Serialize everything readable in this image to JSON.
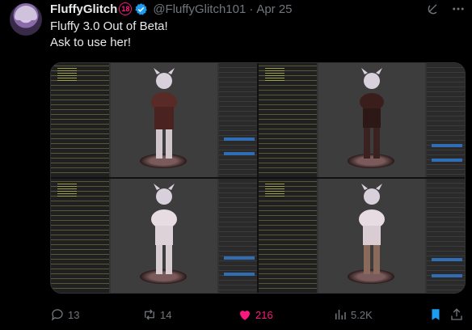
{
  "author": {
    "display_name": "FluffyGlitch",
    "age_badge": "18",
    "handle": "@FluffyGlitch101",
    "separator": "·",
    "date": "Apr 25"
  },
  "post": {
    "line1": "Fluffy 3.0 Out of Beta!",
    "line2": "Ask to use her!"
  },
  "actions": {
    "replies": "13",
    "reposts": "14",
    "likes": "216",
    "views": "5.2K"
  },
  "colors": {
    "accent_like": "#f91880",
    "verified": "#1d9bf0",
    "bookmark": "#1d9bf0",
    "muted": "#71767b"
  },
  "icons": [
    "verified-badge-icon",
    "more-icon",
    "grok-icon",
    "reply-icon",
    "repost-icon",
    "like-icon",
    "views-icon",
    "bookmark-icon",
    "share-icon"
  ]
}
